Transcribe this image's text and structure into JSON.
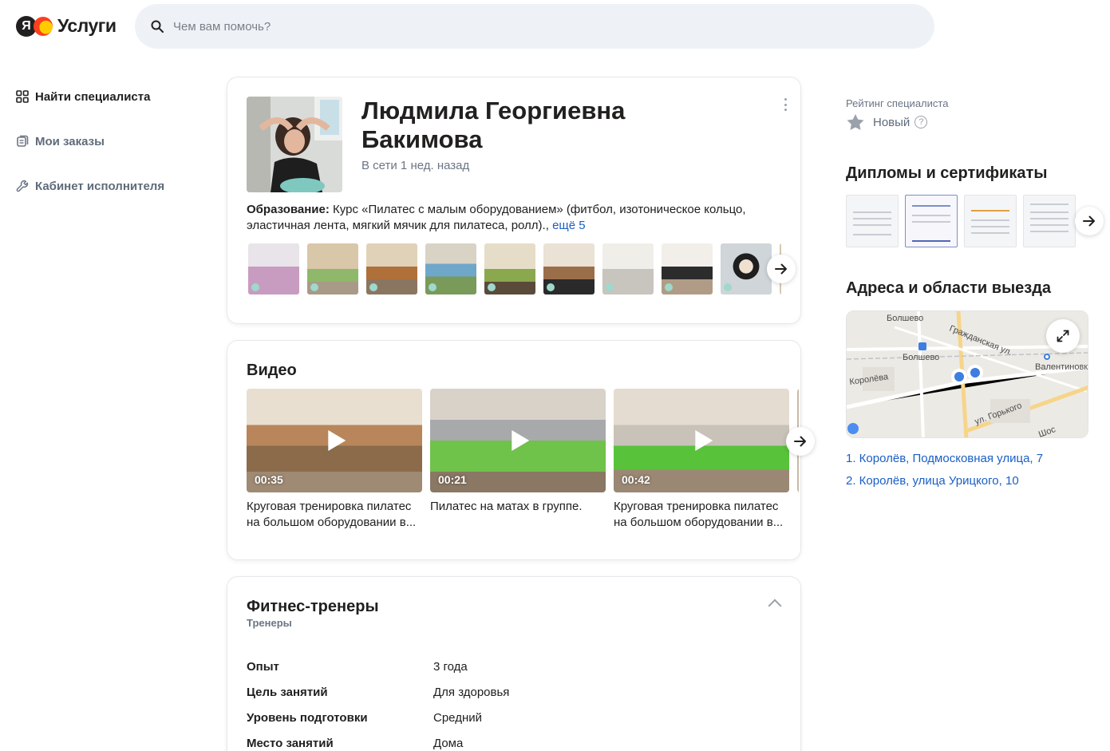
{
  "header": {
    "logo_letter": "Я",
    "logo_text": "Услуги",
    "search_placeholder": "Чем вам помочь?"
  },
  "nav": {
    "items": [
      {
        "label": "Найти специалиста",
        "icon": "grid-icon",
        "active": true
      },
      {
        "label": "Мои заказы",
        "icon": "orders-icon",
        "active": false
      },
      {
        "label": "Кабинет исполнителя",
        "icon": "wrench-icon",
        "active": false
      }
    ]
  },
  "profile": {
    "name": "Людмила Георгиевна Бакимова",
    "online": "В сети 1 нед. назад",
    "education_label": "Образование:",
    "education_text": " Курс «Пилатес с малым оборудованием» (фитбол, изотоническое кольцо, эластичная лента, мягкий мячик для пилатеса, ролл)., ",
    "education_more": "ещё 5"
  },
  "videos": {
    "title": "Видео",
    "items": [
      {
        "duration": "00:35",
        "caption": "Круговая тренировка пилатес на большом оборудовании в..."
      },
      {
        "duration": "00:21",
        "caption": "Пилатес на матах в группе."
      },
      {
        "duration": "00:42",
        "caption": "Круговая тренировка пилатес на большом оборудовании в..."
      }
    ]
  },
  "fitness": {
    "title": "Фитнес-тренеры",
    "subtitle": "Тренеры",
    "props": [
      {
        "key": "Опыт",
        "value": "3 года"
      },
      {
        "key": "Цель занятий",
        "value": "Для здоровья"
      },
      {
        "key": "Уровень подготовки",
        "value": "Средний"
      },
      {
        "key": "Место занятий",
        "value": "Дома"
      }
    ]
  },
  "sidebar": {
    "rating_label": "Рейтинг специалиста",
    "rating_value": "Новый",
    "rating_help": "?",
    "certs_title": "Дипломы и сертификаты",
    "addresses_title": "Адреса и области выезда",
    "map_labels": [
      "Болшево",
      "Гражданская ул.",
      "Болшево",
      "Валентиновка",
      "Королёва",
      "ул. Горького",
      "Шос"
    ],
    "addresses": [
      "1. Королёв, Подмосковная улица, 7",
      "2. Королёв, улица Урицкого, 10"
    ]
  },
  "colors": {
    "link": "#1a5fc6",
    "text": "#21201f",
    "muted": "#6b7585",
    "search_bg": "#eef2f7",
    "map_marker": "#3d7ee0"
  }
}
